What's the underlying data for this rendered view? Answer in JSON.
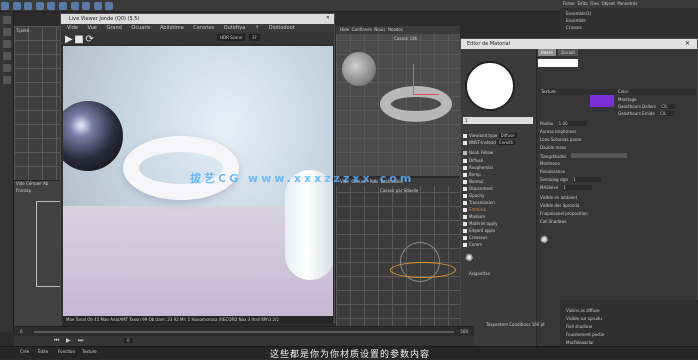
{
  "ir_window": {
    "title": "Live Viewer Jonde (Q0) (5.5)",
    "menu": [
      "Vide",
      "Vue",
      "Grand",
      "Ocuaris",
      "Abilotima",
      "Cararies",
      "Outidtya",
      "↑",
      "Diotiodoot"
    ],
    "render_mode": "HDR Scene",
    "render_count": "3?",
    "status": "Mae Tonal  Oh  45  Mae Ana(AMT  Taxon 99  Ob  Uam: 23  92  Mr: 1  Hanomsnosa (RECORD  Nax 3    Ihall  8Ph3  2/2"
  },
  "viewport_left": {
    "menu": [
      "Vide",
      "Cémaer",
      "Ab"
    ],
    "label_top": "Tijalité",
    "label_bottom": "Frontap"
  },
  "viewport_top": {
    "menu": [
      "Hide",
      "Carifianes",
      "Nouis",
      "Noados"
    ],
    "label": "Casson 186"
  },
  "viewport_bottom": {
    "menu": [
      "Vide",
      "Camaer",
      "Pula",
      "Bastimbles"
    ],
    "label": "Casson par Sdaelle"
  },
  "material_editor": {
    "title": "Edtor de Matorial",
    "name_field": "1",
    "tabs": [
      "Basse",
      "Doradi"
    ],
    "left_options": [
      {
        "label": "Viewiand type",
        "value": "Diffuse",
        "checked": true
      },
      {
        "label": "NNST-Instead",
        "value": "Enmitti",
        "checked": true
      },
      {
        "label": "Noah Follow",
        "checked": false
      },
      {
        "label": "Diffusé",
        "checked": true
      },
      {
        "label": "Roughemiss",
        "checked": true
      },
      {
        "label": "Bemp",
        "checked": true
      },
      {
        "label": "Normal",
        "checked": true
      },
      {
        "label": "Dispcoment",
        "checked": true
      },
      {
        "label": "Opacity",
        "checked": true
      },
      {
        "label": "Transmission",
        "checked": true
      },
      {
        "label": "Emmisie",
        "checked": true
      },
      {
        "label": "Madium",
        "checked": true
      },
      {
        "label": "Matériel apply",
        "checked": true
      },
      {
        "label": "Edgard appis",
        "checked": true
      },
      {
        "label": "Creaseus",
        "checked": true
      },
      {
        "label": "Corem",
        "checked": true
      }
    ],
    "assign_label": "Asigneltan",
    "section_texture": "Texture",
    "section_color": "Color",
    "color_rows": [
      {
        "label": "Monitage",
        "value": ""
      },
      {
        "label": "Geasthours Dellors",
        "value": "CIL"
      },
      {
        "label": "Geasthours Emide",
        "value": "CIL"
      }
    ],
    "accent_color": "#7b2fd8",
    "params": [
      {
        "label": "Poulou",
        "value": "1.00"
      },
      {
        "label": "Aureas brightness",
        "value": ""
      },
      {
        "label": "Lono Solsonas passe",
        "value": ""
      },
      {
        "label": "Dauble maxs",
        "value": ""
      },
      {
        "label": "Tiangrétudes",
        "value": ""
      },
      {
        "label": "Monteone",
        "value": ""
      },
      {
        "label": "Renaissance",
        "value": ""
      },
      {
        "label": "Semiolog sign",
        "value": "1"
      },
      {
        "label": "MASloive",
        "value": "1"
      },
      {
        "label": "Visible on ambient",
        "value": ""
      },
      {
        "label": "Visible des Spronda",
        "value": ""
      },
      {
        "label": "Fnapoisonel proposition",
        "value": ""
      },
      {
        "label": "Call Shadows",
        "value": ""
      }
    ],
    "bottom_label": "Texpentem Conditions 160 pt"
  },
  "object_panel": {
    "tabs": [
      "Ficher",
      "Édito",
      "Files",
      "Objeet",
      "Pannetrés"
    ],
    "items": [
      "Ensemble(1)",
      "Ensemble",
      "Crasses"
    ]
  },
  "attribute_list": [
    "Violins as diffuse",
    "Visible sur sprudu",
    "Fiell shodinar",
    "Fouistement pectie",
    "Mocfaleaoclar"
  ],
  "timeline": {
    "frame_start": "0",
    "frame_end": "500",
    "current": "0"
  },
  "manager_tabs": [
    "Crée",
    "Édite",
    "Fonction",
    "Texture"
  ],
  "subtitle": "这些都是你为你材质设置的参数内容",
  "watermark": "拔艺CG  www.xxxzzzxx.com"
}
